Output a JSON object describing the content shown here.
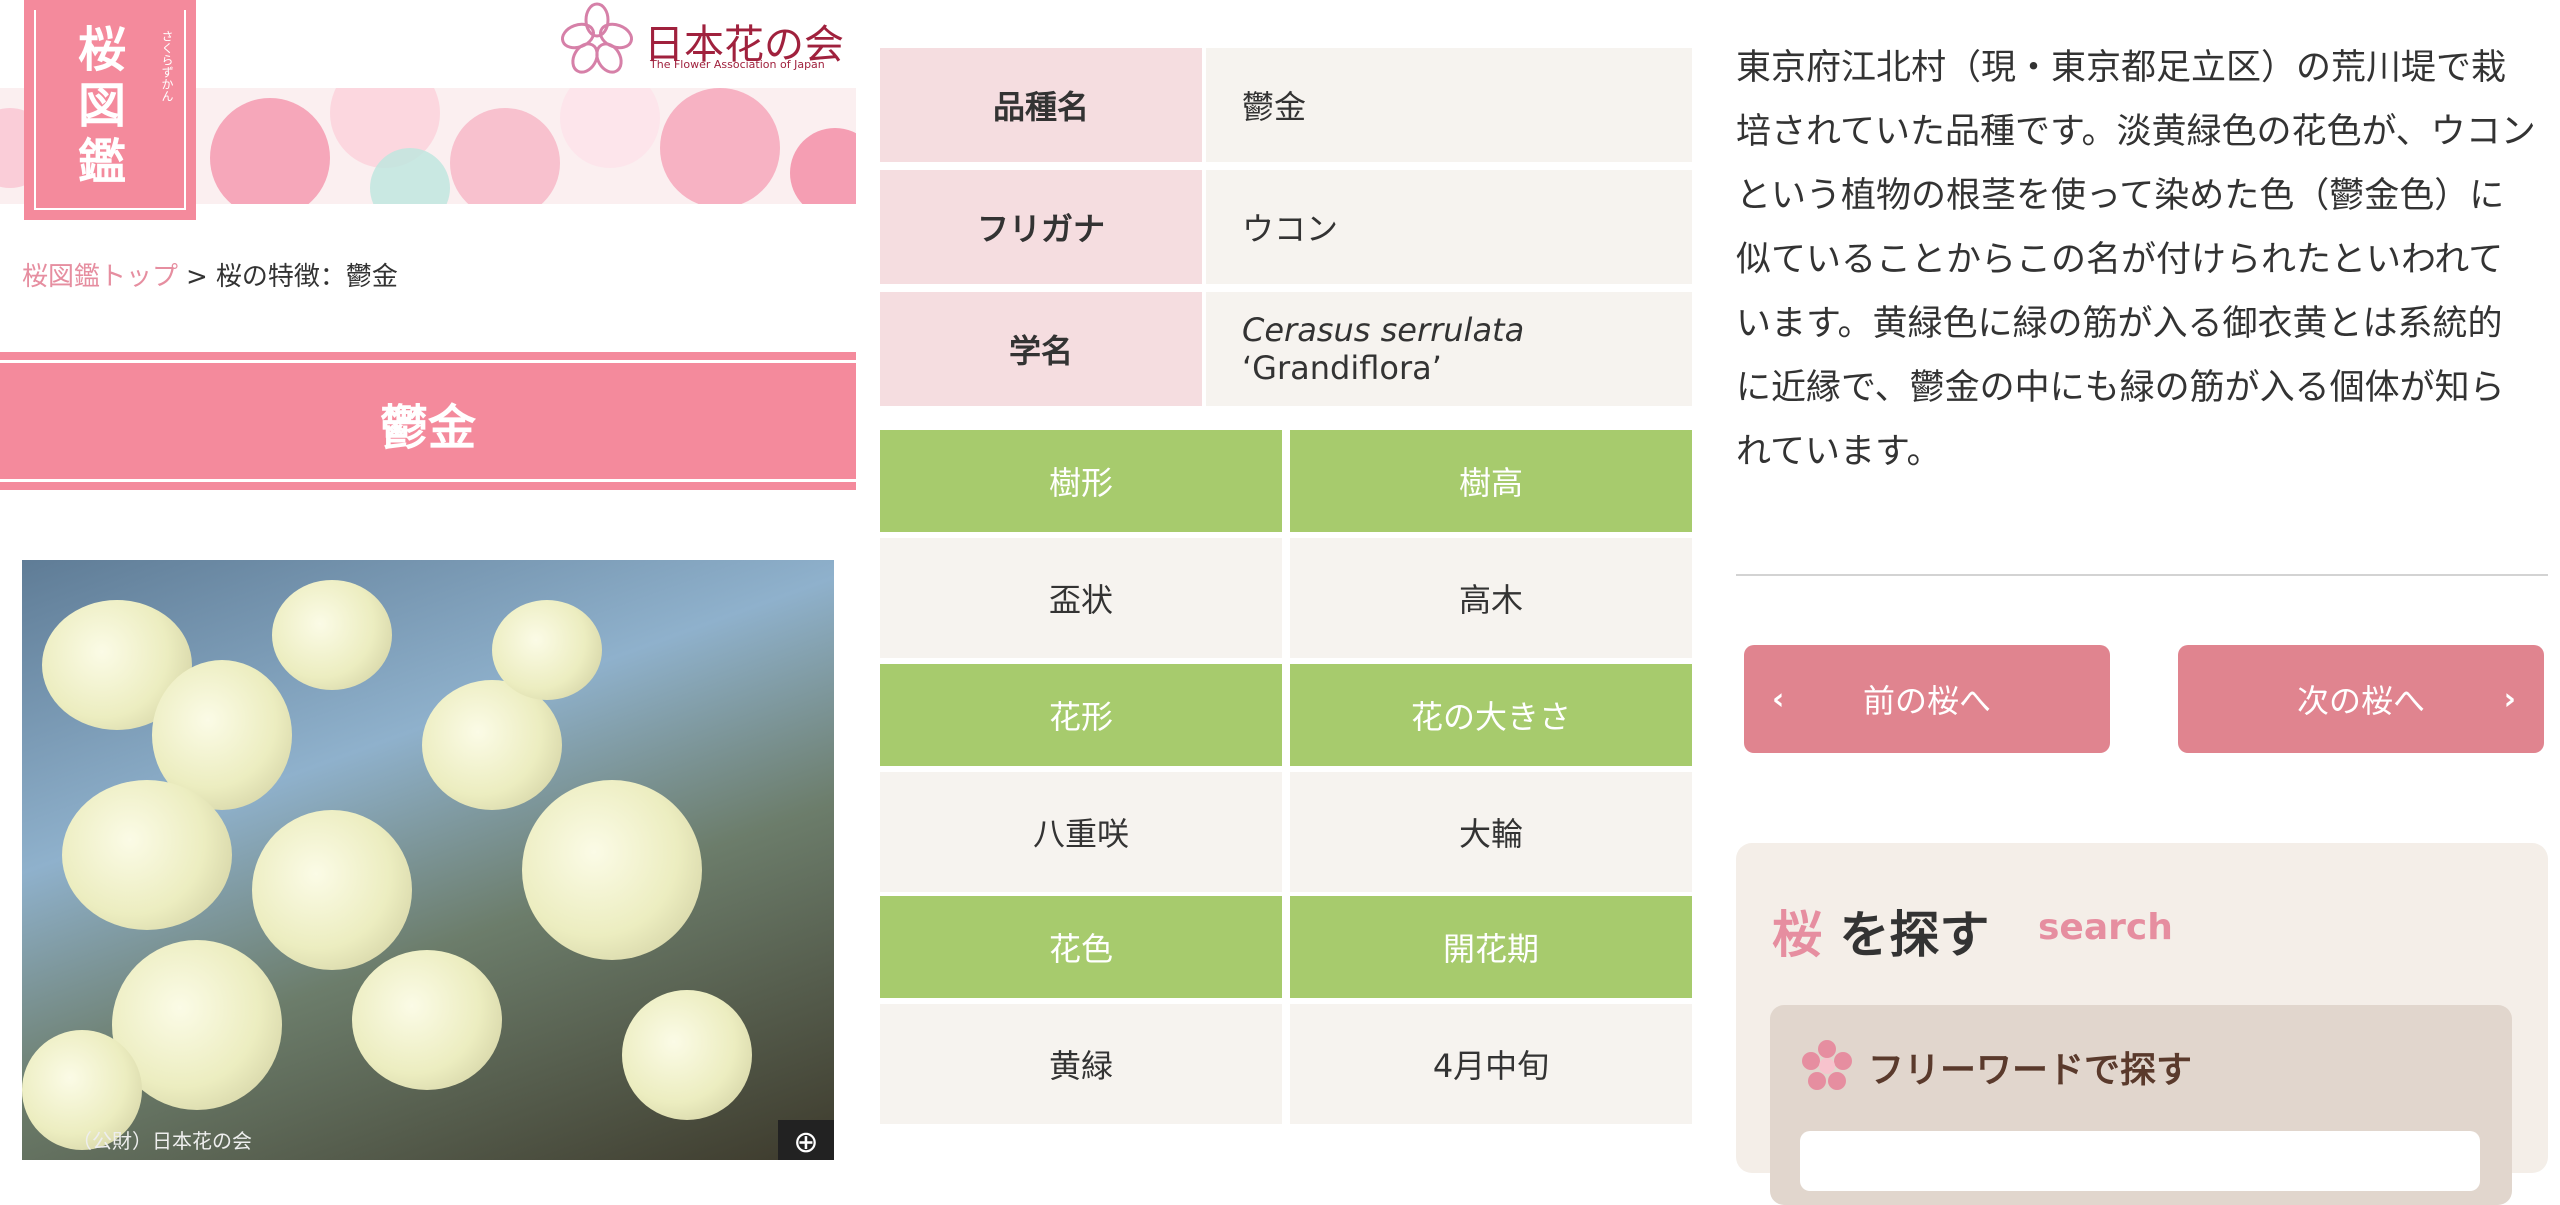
{
  "logo": {
    "title": "桜図鑑",
    "ruby": "さくらずかん"
  },
  "association": {
    "name": "日本花の会",
    "english": "The Flower Association of Japan"
  },
  "breadcrumb": {
    "home": "桜図鑑トップ",
    "separator": ">",
    "current": "桜の特徴：鬱金"
  },
  "page_title": "鬱金",
  "photo": {
    "credit": "（公財）日本花の会",
    "zoom_icon": "zoom-in-icon"
  },
  "info_table": [
    {
      "label": "品種名",
      "value": "鬱金"
    },
    {
      "label": "フリガナ",
      "value": "ウコン"
    },
    {
      "label": "学名",
      "value_latin": "Cerasus serrulata",
      "value_cultivar": "‘Grandiflora’"
    }
  ],
  "features": [
    {
      "left_head": "樹形",
      "right_head": "樹高",
      "left_value": "盃状",
      "right_value": "高木"
    },
    {
      "left_head": "花形",
      "right_head": "花の大きさ",
      "left_value": "八重咲",
      "right_value": "大輪"
    },
    {
      "left_head": "花色",
      "right_head": "開花期",
      "left_value": "黄緑",
      "right_value": "4月中旬"
    }
  ],
  "description": "東京府江北村（現・東京都足立区）の荒川堤で栽培されていた品種です。淡黄緑色の花色が、ウコンという植物の根茎を使って染めた色（鬱金色）に似ていることからこの名が付けられたといわれています。黄緑色に緑の筋が入る御衣黄とは系統的に近縁で、鬱金の中にも緑の筋が入る個体が知られています。",
  "navigation": {
    "prev_label": "前の桜へ",
    "next_label": "次の桜へ",
    "prev_icon": "‹",
    "next_icon": "›"
  },
  "search": {
    "heading_accent": "桜",
    "heading_rest": "を探す",
    "subheading": "search",
    "freeword_label": "フリーワードで探す",
    "freeword_placeholder": ""
  },
  "colors": {
    "brand_pink": "#f48a9c",
    "label_pink": "#f5dde0",
    "feature_green": "#a7cb6d",
    "button_pink": "#e0848f",
    "link_pink": "#e68ea0"
  }
}
